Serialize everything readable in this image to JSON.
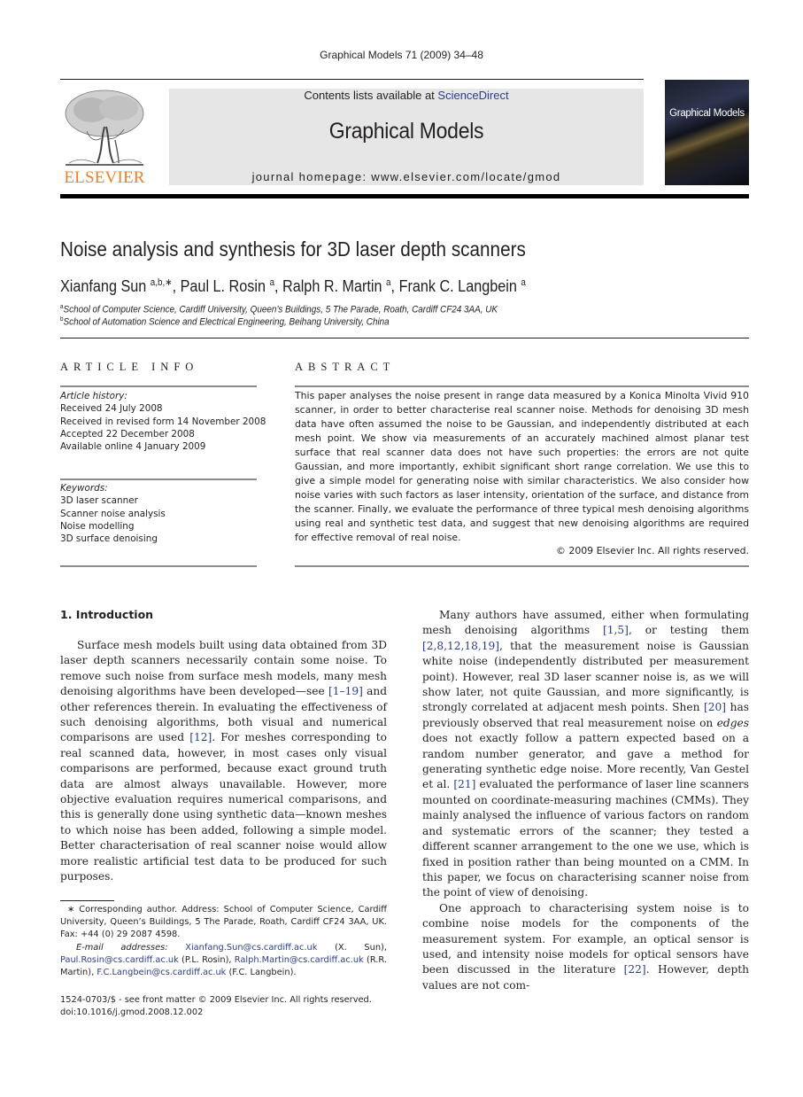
{
  "running_head": "Graphical Models 71 (2009) 34–48",
  "header": {
    "contents_prefix": "Contents lists available at ",
    "contents_link": "ScienceDirect",
    "journal_title": "Graphical Models",
    "homepage": "journal homepage: www.elsevier.com/locate/gmod",
    "publisher_logo_text": "ELSEVIER",
    "cover_title": "Graphical Models"
  },
  "colors": {
    "link": "#2b3d8f",
    "elsevier_orange": "#f47d20",
    "header_box": "#e6e6e6"
  },
  "article": {
    "title": "Noise analysis and synthesis for 3D laser depth scanners",
    "authors": [
      {
        "name": "Xianfang Sun",
        "sup": "a,b,∗"
      },
      {
        "name": "Paul L. Rosin",
        "sup": "a"
      },
      {
        "name": "Ralph R. Martin",
        "sup": "a"
      },
      {
        "name": "Frank C. Langbein",
        "sup": "a"
      }
    ],
    "affiliations": [
      {
        "mark": "a",
        "text": "School of Computer Science, Cardiff University, Queen’s Buildings, 5 The Parade, Roath, Cardiff CF24 3AA, UK"
      },
      {
        "mark": "b",
        "text": "School of Automation Science and Electrical Engineering, Beihang University, China"
      }
    ]
  },
  "article_info": {
    "heading": "ARTICLE INFO",
    "history_label": "Article history:",
    "history": [
      "Received 24 July 2008",
      "Received in revised form 14 November 2008",
      "Accepted 22 December 2008",
      "Available online 4 January 2009"
    ],
    "keywords_label": "Keywords:",
    "keywords": [
      "3D laser scanner",
      "Scanner noise analysis",
      "Noise modelling",
      "3D surface denoising"
    ]
  },
  "abstract": {
    "heading": "ABSTRACT",
    "text": "This paper analyses the noise present in range data measured by a Konica Minolta Vivid 910 scanner, in order to better characterise real scanner noise. Methods for denoising 3D mesh data have often assumed the noise to be Gaussian, and independently distributed at each mesh point. We show via measurements of an accurately machined almost planar test surface that real scanner data does not have such properties: the errors are not quite Gaussian, and more importantly, exhibit significant short range correlation. We use this to give a simple model for generating noise with similar characteristics. We also consider how noise varies with such factors as laser intensity, orientation of the surface, and distance from the scanner. Finally, we evaluate the performance of three typical mesh denoising algorithms using real and synthetic test data, and suggest that new denoising algorithms are required for effective removal of real noise.",
    "copyright": "© 2009 Elsevier Inc. All rights reserved."
  },
  "introduction": {
    "heading": "1.  Introduction",
    "left_para": [
      {
        "t": "Surface mesh models built using data obtained from 3D laser depth scanners necessarily contain some noise. To remove such noise from surface mesh models, many mesh denoising algorithms have been developed—see "
      },
      {
        "ref": "[1–19]"
      },
      {
        "t": " and other references therein. In evaluating the effectiveness of such denoising algorithms, both visual and numerical comparisons are used "
      },
      {
        "ref": "[12]"
      },
      {
        "t": ". For meshes corresponding to real scanned data, however, in most cases only visual comparisons are performed, because exact ground truth data are almost always unavailable. However, more objective evaluation requires numerical comparisons, and this is generally done using synthetic data—known meshes to which noise has been added, following a simple model. Better characterisation of real scanner noise would allow more realistic artificial test data to be produced for such purposes."
      }
    ],
    "right_para_1": [
      {
        "t": "Many authors have assumed, either when formulating mesh denoising algorithms "
      },
      {
        "ref": "[1,5]"
      },
      {
        "t": ", or testing them "
      },
      {
        "ref": "[2,8,12,18,19]"
      },
      {
        "t": ", that the measurement noise is Gaussian white noise (independently distributed per measurement point). However, real 3D laser scanner noise is, as we will show later, not quite Gaussian, and more significantly, is strongly correlated at adjacent mesh points. Shen "
      },
      {
        "ref": "[20]"
      },
      {
        "t": " has previously observed that real measurement noise on "
      },
      {
        "em": "edges"
      },
      {
        "t": " does not exactly follow a pattern expected based on a random number generator, and gave a method for generating synthetic edge noise. More recently, Van Gestel et al. "
      },
      {
        "ref": "[21]"
      },
      {
        "t": " evaluated the performance of laser line scanners mounted on coordinate-measuring machines (CMMs). They mainly analysed the influence of various factors on random and systematic errors of the scanner; they tested a different scanner arrangement to the one we use, which is fixed in position rather than being mounted on a CMM. In this paper, we focus on characterising scanner noise from the point of view of denoising."
      }
    ],
    "right_para_2": [
      {
        "t": "One approach to characterising system noise is to combine noise models for the components of the measurement system. For example, an optical sensor is used, and intensity noise models for optical sensors have been discussed in the literature "
      },
      {
        "ref": "[22]"
      },
      {
        "t": ". However, depth values are not com-"
      }
    ]
  },
  "footnotes": {
    "corresponding": "∗ Corresponding author. Address: School of Computer Science, Cardiff University, Queen’s Buildings, 5 The Parade, Roath, Cardiff CF24 3AA, UK. Fax: +44 (0) 29 2087 4598.",
    "email_label": "E-mail addresses:",
    "emails": [
      {
        "addr": "Xianfang.Sun@cs.cardiff.ac.uk",
        "who": " (X. Sun), "
      },
      {
        "addr": "Paul.Rosin@cs.cardiff.ac.uk",
        "who": " (P.L. Rosin), "
      },
      {
        "addr": "Ralph.Martin@cs.cardiff.ac.uk",
        "who": " (R.R. Martin), "
      },
      {
        "addr": "F.C.Langbein@cs.cardiff.ac.uk",
        "who": " (F.C. Langbein)."
      }
    ]
  },
  "front_matter": {
    "issn_line": "1524-0703/$ - see front matter © 2009 Elsevier Inc. All rights reserved.",
    "doi": "doi:10.1016/j.gmod.2008.12.002"
  }
}
